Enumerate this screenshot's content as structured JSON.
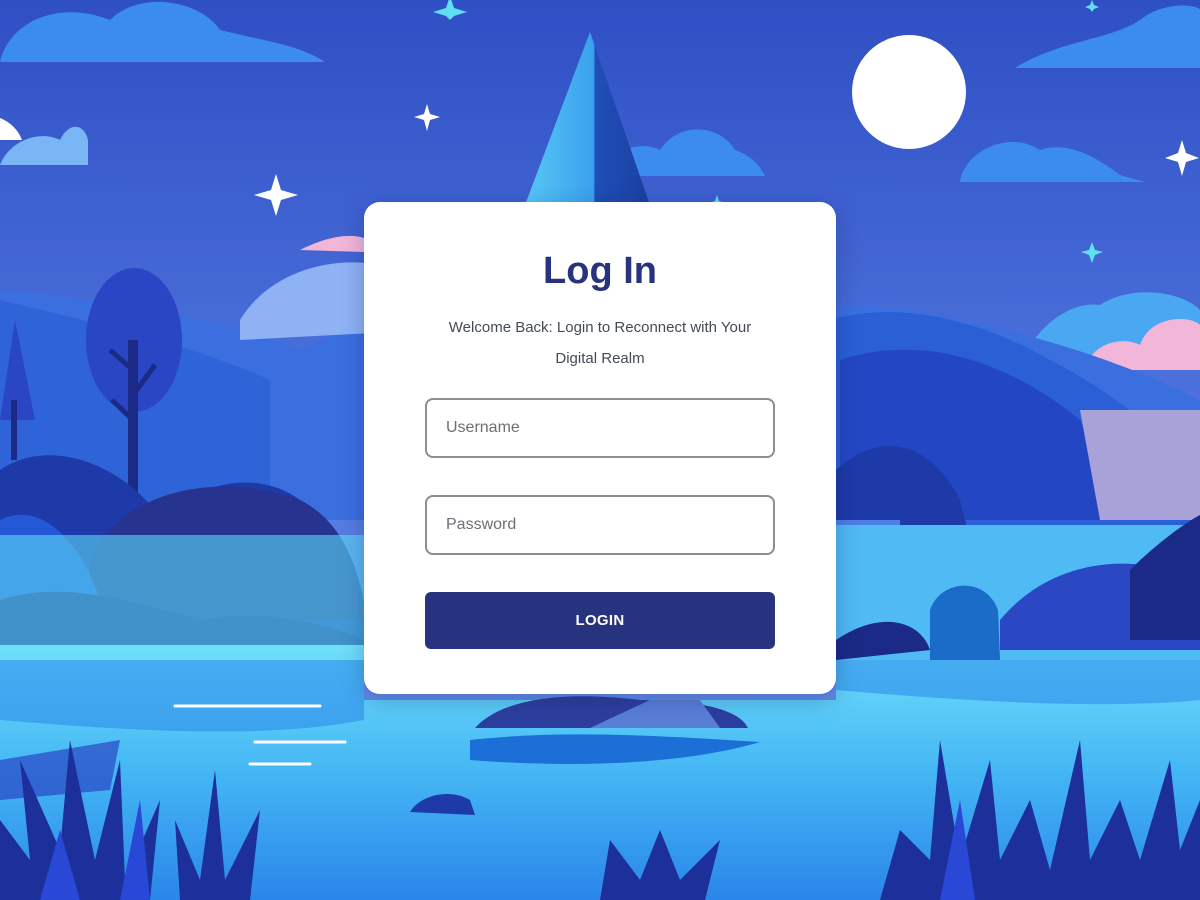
{
  "login": {
    "title": "Log In",
    "subtitle": "Welcome Back: Login to Reconnect with Your Digital Realm",
    "username_placeholder": "Username",
    "password_placeholder": "Password",
    "button_label": "LOGIN"
  },
  "theme": {
    "accent": "#27337e",
    "sky_top": "#3456c8",
    "sky_bottom": "#5a86e6",
    "water": "#5cc8f5",
    "foreground": "#1a2f8a"
  },
  "background": {
    "scene": "night-landscape-illustration",
    "icons": [
      "moon-icon",
      "star-icon",
      "cloud-icon",
      "mountain-icon",
      "tree-icon",
      "grass-icon"
    ]
  }
}
